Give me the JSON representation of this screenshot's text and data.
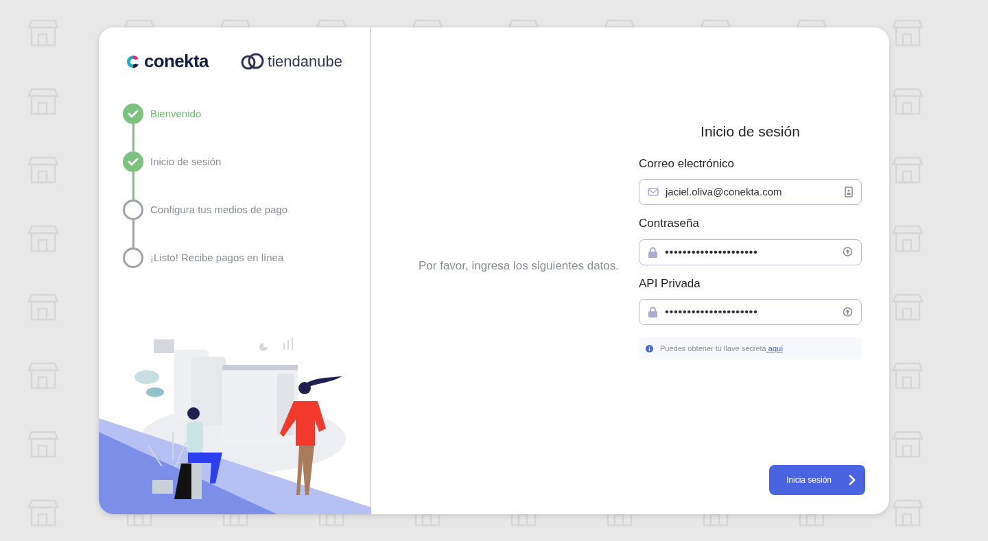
{
  "logos": {
    "primary": "conekta",
    "partner": "tiendanube"
  },
  "steps": [
    {
      "label": "Bienvenido",
      "done": true,
      "current": true
    },
    {
      "label": "Inicio de sesión",
      "done": true,
      "current": false
    },
    {
      "label": "Configura tus medios de pago",
      "done": false,
      "current": false
    },
    {
      "label": "¡Listo! Recibe pagos en línea",
      "done": false,
      "current": false
    }
  ],
  "prompt": "Por favor, ingresa los siguientes datos.",
  "form": {
    "title": "Inicio de sesión",
    "fields": [
      {
        "label": "Correo electrónico",
        "kind": "email",
        "value": "jaciel.oliva@conekta.com"
      },
      {
        "label": "Contraseña",
        "kind": "secret",
        "value": "•••••••••••••••••••••"
      },
      {
        "label": "API Privada",
        "kind": "secret",
        "value": "•••••••••••••••••••••"
      }
    ],
    "hint": {
      "text": "Puedes obtener tu llave secreta",
      "link": " aquí"
    },
    "submit": "Inicia sesión"
  }
}
